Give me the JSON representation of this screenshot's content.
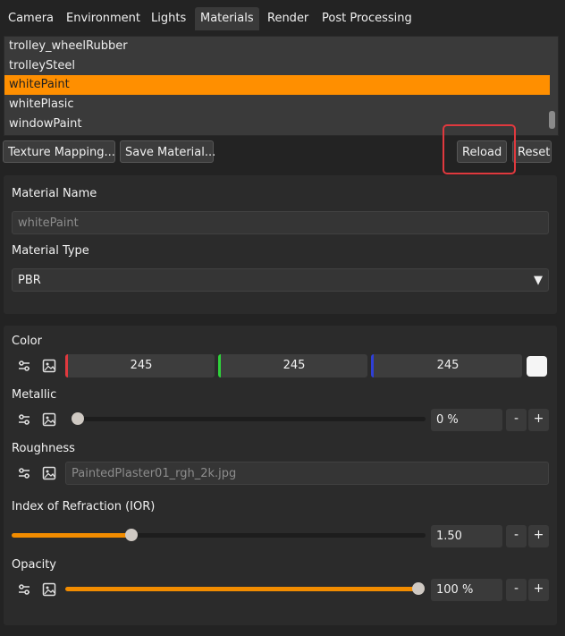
{
  "tabs": [
    "Camera",
    "Environment",
    "Lights",
    "Materials",
    "Render",
    "Post Processing"
  ],
  "materials_list": [
    "trolley_wheelRubber",
    "trolleySteel",
    "whitePaint",
    "whitePlasic",
    "windowPaint"
  ],
  "selected_material": "whitePaint",
  "buttons": {
    "texture_mapping": "Texture Mapping...",
    "save_material": "Save Material...",
    "reload": "Reload",
    "reset": "Reset"
  },
  "material_name": {
    "label": "Material Name",
    "value": "whitePaint"
  },
  "material_type": {
    "label": "Material Type",
    "value": "PBR"
  },
  "color": {
    "label": "Color",
    "r": "245",
    "g": "245",
    "b": "245",
    "swatch": "#f5f5f5"
  },
  "metallic": {
    "label": "Metallic",
    "value_text": "0 %",
    "fraction": 0.0
  },
  "roughness": {
    "label": "Roughness",
    "texture": "PaintedPlaster01_rgh_2k.jpg"
  },
  "ior": {
    "label": "Index of Refraction (IOR)",
    "value_text": "1.50",
    "fraction": 0.29
  },
  "opacity": {
    "label": "Opacity",
    "value_text": "100 %",
    "fraction": 1.0
  },
  "stepper": {
    "minus": "-",
    "plus": "+"
  },
  "accent_color": "#ff8f00",
  "icons": {
    "sliders": "sliders-icon",
    "image": "image-icon",
    "dropdown": "triangle-down-icon"
  }
}
